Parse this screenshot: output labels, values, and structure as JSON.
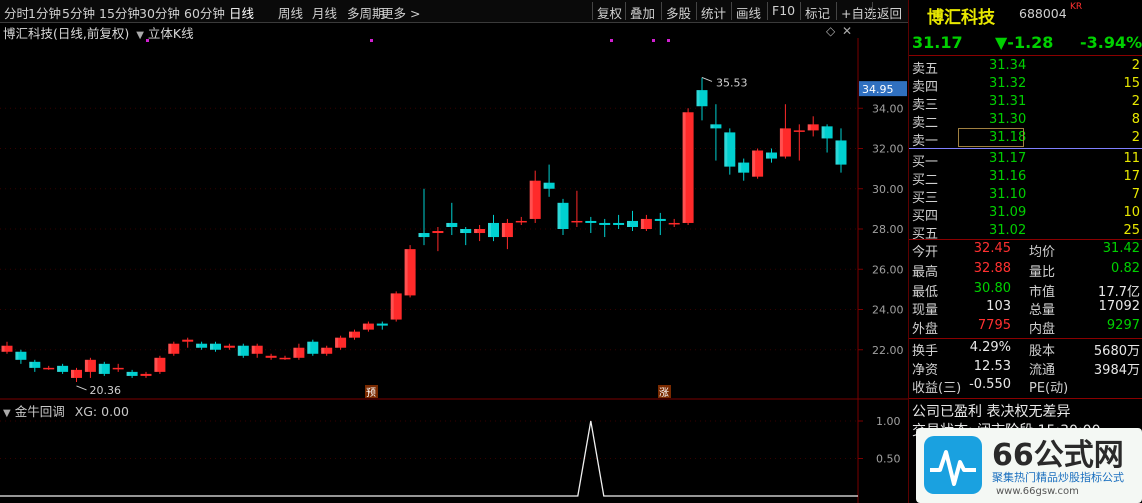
{
  "toolbar": {
    "tabs": [
      "分时",
      "1分钟",
      "5分钟",
      "15分钟",
      "30分钟",
      "60分钟",
      "日线",
      "周线",
      "月线",
      "多周期",
      "更多 >"
    ],
    "active": "日线",
    "right_buttons": [
      "复权",
      "叠加",
      "多股",
      "统计",
      "画线",
      "F10",
      "标记",
      "+自选",
      "返回"
    ]
  },
  "chart": {
    "title": "博汇科技(日线,前复权)",
    "mode": "立体K线",
    "current_price_tag": "34.95",
    "high_marker": "35.53",
    "low_marker": "20.36",
    "marker_yu": "预",
    "marker_zhang": "涨",
    "price_ticks": [
      "34.00",
      "32.00",
      "30.00",
      "28.00",
      "26.00",
      "24.00",
      "22.00"
    ]
  },
  "chart_data": {
    "type": "candlestick",
    "ylim": [
      20,
      36
    ],
    "candles": [
      {
        "o": 21.9,
        "c": 22.2,
        "h": 22.4,
        "l": 21.8
      },
      {
        "o": 21.9,
        "c": 21.5,
        "h": 22.0,
        "l": 21.3
      },
      {
        "o": 21.4,
        "c": 21.1,
        "h": 21.5,
        "l": 20.9
      },
      {
        "o": 21.1,
        "c": 21.1,
        "h": 21.2,
        "l": 21.0
      },
      {
        "o": 21.2,
        "c": 20.9,
        "h": 21.3,
        "l": 20.8
      },
      {
        "o": 20.6,
        "c": 21.0,
        "h": 21.1,
        "l": 20.4
      },
      {
        "o": 20.9,
        "c": 21.5,
        "h": 21.6,
        "l": 20.6
      },
      {
        "o": 21.3,
        "c": 20.8,
        "h": 21.4,
        "l": 20.7
      },
      {
        "o": 21.1,
        "c": 21.1,
        "h": 21.3,
        "l": 20.9
      },
      {
        "o": 20.9,
        "c": 20.7,
        "h": 21.0,
        "l": 20.6
      },
      {
        "o": 20.7,
        "c": 20.8,
        "h": 20.9,
        "l": 20.6
      },
      {
        "o": 20.9,
        "c": 21.6,
        "h": 21.7,
        "l": 20.8
      },
      {
        "o": 21.8,
        "c": 22.3,
        "h": 22.4,
        "l": 21.7
      },
      {
        "o": 22.4,
        "c": 22.5,
        "h": 22.6,
        "l": 22.1
      },
      {
        "o": 22.3,
        "c": 22.1,
        "h": 22.4,
        "l": 22.0
      },
      {
        "o": 22.3,
        "c": 22.0,
        "h": 22.4,
        "l": 21.9
      },
      {
        "o": 22.1,
        "c": 22.2,
        "h": 22.3,
        "l": 22.0
      },
      {
        "o": 22.2,
        "c": 21.7,
        "h": 22.3,
        "l": 21.6
      },
      {
        "o": 21.8,
        "c": 22.2,
        "h": 22.3,
        "l": 21.6
      },
      {
        "o": 21.6,
        "c": 21.7,
        "h": 21.8,
        "l": 21.5
      },
      {
        "o": 21.6,
        "c": 21.6,
        "h": 21.7,
        "l": 21.5
      },
      {
        "o": 21.6,
        "c": 22.1,
        "h": 22.3,
        "l": 21.5
      },
      {
        "o": 22.4,
        "c": 21.8,
        "h": 22.5,
        "l": 21.7
      },
      {
        "o": 21.8,
        "c": 22.1,
        "h": 22.2,
        "l": 21.7
      },
      {
        "o": 22.1,
        "c": 22.6,
        "h": 22.7,
        "l": 22.0
      },
      {
        "o": 22.6,
        "c": 22.9,
        "h": 23.0,
        "l": 22.5
      },
      {
        "o": 23.0,
        "c": 23.3,
        "h": 23.4,
        "l": 22.9
      },
      {
        "o": 23.3,
        "c": 23.2,
        "h": 23.4,
        "l": 23.0
      },
      {
        "o": 23.5,
        "c": 24.8,
        "h": 24.9,
        "l": 23.4
      },
      {
        "o": 24.7,
        "c": 27.0,
        "h": 27.2,
        "l": 24.6
      },
      {
        "o": 27.8,
        "c": 27.6,
        "h": 30.0,
        "l": 27.2
      },
      {
        "o": 27.8,
        "c": 27.9,
        "h": 28.1,
        "l": 26.9
      },
      {
        "o": 28.3,
        "c": 28.1,
        "h": 29.3,
        "l": 27.7
      },
      {
        "o": 28.0,
        "c": 27.8,
        "h": 28.1,
        "l": 27.2
      },
      {
        "o": 27.8,
        "c": 28.0,
        "h": 28.2,
        "l": 27.4
      },
      {
        "o": 28.3,
        "c": 27.6,
        "h": 28.7,
        "l": 27.4
      },
      {
        "o": 27.6,
        "c": 28.3,
        "h": 28.5,
        "l": 27.0
      },
      {
        "o": 28.4,
        "c": 28.4,
        "h": 28.6,
        "l": 28.2
      },
      {
        "o": 28.5,
        "c": 30.4,
        "h": 30.9,
        "l": 28.3
      },
      {
        "o": 30.3,
        "c": 30.0,
        "h": 31.2,
        "l": 29.6
      },
      {
        "o": 29.3,
        "c": 28.0,
        "h": 29.5,
        "l": 27.7
      },
      {
        "o": 28.4,
        "c": 28.4,
        "h": 29.9,
        "l": 28.1
      },
      {
        "o": 28.4,
        "c": 28.3,
        "h": 28.6,
        "l": 27.8
      },
      {
        "o": 28.3,
        "c": 28.2,
        "h": 28.5,
        "l": 27.6
      },
      {
        "o": 28.3,
        "c": 28.2,
        "h": 28.7,
        "l": 28.0
      },
      {
        "o": 28.4,
        "c": 28.1,
        "h": 28.9,
        "l": 27.9
      },
      {
        "o": 28.0,
        "c": 28.5,
        "h": 28.7,
        "l": 27.9
      },
      {
        "o": 28.5,
        "c": 28.4,
        "h": 28.8,
        "l": 27.7
      },
      {
        "o": 28.3,
        "c": 28.3,
        "h": 28.5,
        "l": 28.1
      },
      {
        "o": 28.3,
        "c": 33.8,
        "h": 34.0,
        "l": 28.2
      },
      {
        "o": 34.9,
        "c": 34.1,
        "h": 35.53,
        "l": 33.4
      },
      {
        "o": 33.2,
        "c": 33.0,
        "h": 34.2,
        "l": 31.4
      },
      {
        "o": 32.8,
        "c": 31.1,
        "h": 33.0,
        "l": 30.7
      },
      {
        "o": 31.3,
        "c": 30.8,
        "h": 31.5,
        "l": 30.4
      },
      {
        "o": 30.6,
        "c": 31.9,
        "h": 32.0,
        "l": 30.5
      },
      {
        "o": 31.8,
        "c": 31.5,
        "h": 32.0,
        "l": 31.3
      },
      {
        "o": 31.6,
        "c": 33.0,
        "h": 34.2,
        "l": 31.5
      },
      {
        "o": 32.9,
        "c": 32.9,
        "h": 33.2,
        "l": 31.4
      },
      {
        "o": 32.9,
        "c": 33.2,
        "h": 33.6,
        "l": 32.6
      },
      {
        "o": 33.1,
        "c": 32.5,
        "h": 33.2,
        "l": 31.8
      },
      {
        "o": 32.4,
        "c": 31.2,
        "h": 33.0,
        "l": 30.8
      }
    ]
  },
  "indicator": {
    "title": "金牛回调",
    "value": "XG: 0.00",
    "ticks": [
      "1.00",
      "0.50"
    ],
    "signal_index": 42,
    "signal_value": 1.0
  },
  "quote": {
    "name": "博汇科技",
    "code": "688004",
    "tag": "KR",
    "price": "31.17",
    "change": "▼-1.28",
    "change_pct": "-3.94%",
    "sell": [
      {
        "label": "卖五",
        "price": "31.34",
        "vol": "2"
      },
      {
        "label": "卖四",
        "price": "31.32",
        "vol": "15"
      },
      {
        "label": "卖三",
        "price": "31.31",
        "vol": "2"
      },
      {
        "label": "卖二",
        "price": "31.30",
        "vol": "8"
      },
      {
        "label": "卖一",
        "price": "31.18",
        "vol": "2"
      }
    ],
    "buy": [
      {
        "label": "买一",
        "price": "31.17",
        "vol": "11"
      },
      {
        "label": "买二",
        "price": "31.16",
        "vol": "17"
      },
      {
        "label": "买三",
        "price": "31.10",
        "vol": "7"
      },
      {
        "label": "买四",
        "price": "31.09",
        "vol": "10"
      },
      {
        "label": "买五",
        "price": "31.02",
        "vol": "25"
      }
    ],
    "stats": [
      {
        "l1": "今开",
        "v1": "32.45",
        "c1": "red",
        "l2": "均价",
        "v2": "31.42",
        "c2": "green"
      },
      {
        "l1": "最高",
        "v1": "32.88",
        "c1": "red",
        "l2": "量比",
        "v2": "0.82",
        "c2": "green"
      },
      {
        "l1": "最低",
        "v1": "30.80",
        "c1": "green",
        "l2": "市值",
        "v2": "17.7亿",
        "c2": "white"
      },
      {
        "l1": "现量",
        "v1": "103",
        "c1": "white",
        "l2": "总量",
        "v2": "17092",
        "c2": "white"
      },
      {
        "l1": "外盘",
        "v1": "7795",
        "c1": "red",
        "l2": "内盘",
        "v2": "9297",
        "c2": "green"
      }
    ],
    "stats2": [
      {
        "l1": "换手",
        "v1": "4.29%",
        "l2": "股本",
        "v2": "5680万"
      },
      {
        "l1": "净资",
        "v1": "12.53",
        "l2": "流通",
        "v2": "3984万"
      },
      {
        "l1": "收益(三)",
        "v1": "-0.550",
        "l2": "PE(动)",
        "v2": ""
      }
    ],
    "notice": "公司已盈利 表决权无差异",
    "notice2": "交易状态: 闭市阶段 15:30:00"
  },
  "watermark": {
    "title": "66公式网",
    "slogan": "聚集热门精品炒股指标公式",
    "url": "www.66gsw.com"
  },
  "colors": {
    "up": "#ff2a2a",
    "down": "#00d0d0",
    "grid": "#5a0000",
    "accent_yellow": "#e8e800"
  }
}
